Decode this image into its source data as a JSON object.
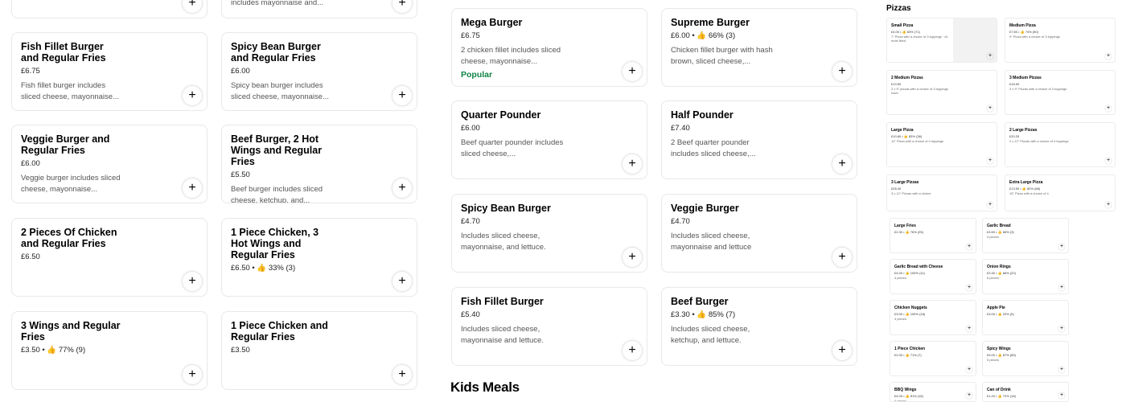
{
  "left_col1": [
    {
      "title": "",
      "price": "",
      "desc": "",
      "plus": "+"
    },
    {
      "title": "Fish Fillet Burger and Regular Fries",
      "price": "£6.75",
      "desc": "Fish fillet burger includes sliced cheese, mayonnaise...",
      "plus": "+"
    },
    {
      "title": "Veggie Burger and Regular Fries",
      "price": "£6.00",
      "desc": "Veggie burger includes sliced cheese, mayonnaise...",
      "plus": "+"
    },
    {
      "title": "2 Pieces Of Chicken and Regular Fries",
      "price": "£6.50",
      "desc": "",
      "plus": "+"
    },
    {
      "title": "3 Wings and Regular Fries",
      "price": "£3.50 • 👍 77% (9)",
      "desc": "",
      "plus": "+"
    }
  ],
  "left_col2": [
    {
      "title": "",
      "price": "",
      "desc": "includes mayonnaise and...",
      "plus": "+"
    },
    {
      "title": "Spicy Bean Burger and Regular Fries",
      "price": "£6.00",
      "desc": "Spicy bean burger includes sliced cheese, mayonnaise...",
      "plus": "+"
    },
    {
      "title": "Beef Burger, 2 Hot Wings and Regular Fries",
      "price": "£5.50",
      "desc": "Beef burger includes sliced cheese, ketchup, and...",
      "plus": "+"
    },
    {
      "title": "1 Piece Chicken, 3 Hot Wings and Regular Fries",
      "price": "£6.50 • 👍 33% (3)",
      "desc": "",
      "plus": "+"
    },
    {
      "title": "1 Piece Chicken and Regular Fries",
      "price": "£3.50",
      "desc": "",
      "plus": "+"
    }
  ],
  "mid_col1": [
    {
      "title": "Mega Burger",
      "price": "£6.75",
      "desc": "2 chicken fillet includes sliced cheese, mayonnaise...",
      "popular": "Popular",
      "plus": "+"
    },
    {
      "title": "Quarter Pounder",
      "price": "£6.00",
      "desc": "Beef quarter pounder includes sliced cheese,...",
      "popular": "",
      "plus": "+"
    },
    {
      "title": "Spicy Bean Burger",
      "price": "£4.70",
      "desc": "Includes sliced cheese, mayonnaise, and lettuce.",
      "popular": "",
      "plus": "+"
    },
    {
      "title": "Fish Fillet Burger",
      "price": "£5.40",
      "desc": "Includes sliced cheese, mayonnaise and lettuce.",
      "popular": "",
      "plus": "+"
    }
  ],
  "mid_col2": [
    {
      "title": "Supreme Burger",
      "price": "£6.00 • 👍 66% (3)",
      "desc": "Chicken fillet burger with hash brown, sliced cheese,...",
      "plus": "+"
    },
    {
      "title": "Half Pounder",
      "price": "£7.40",
      "desc": "2 Beef quarter pounder includes sliced cheese,...",
      "plus": "+"
    },
    {
      "title": "Veggie Burger",
      "price": "£4.70",
      "desc": "Includes sliced cheese, mayonnaise and lettuce",
      "plus": "+"
    },
    {
      "title": "Beef Burger",
      "price": "£3.30 • 👍 85% (7)",
      "desc": "Includes sliced cheese, ketchup, and lettuce.",
      "plus": "+"
    }
  ],
  "kids_meals_title": "Kids Meals",
  "right_panel": {
    "title": "Pizzas",
    "pizzas": [
      {
        "t": "Small Pizza",
        "p": "£4.00 • 👍 83% (71)",
        "d": "7\" Pizza with a choice of 3 toppings · #1 most liked"
      },
      {
        "t": "Medium Pizza",
        "p": "£7.50 • 👍 74% (50)",
        "d": "9\" Pizza with a choice of 3 toppings"
      },
      {
        "t": "2 Medium Pizzas",
        "p": "£13.50",
        "d": "2 x 9\" pizzas with a choice of 3 toppings each"
      },
      {
        "t": "3 Medium Pizzas",
        "p": "£18.90",
        "d": "3 x 9\" Pizzas with a choice of 3 toppings"
      },
      {
        "t": "Large Pizza",
        "p": "£10.80 • 👍 83% (36)",
        "d": "12\" Pizza with a choice of 4 toppings"
      },
      {
        "t": "2 Large Pizzas",
        "p": "£20.25",
        "d": "2 x 12\" Pizzas with a choice of 4 toppings"
      },
      {
        "t": "3 Large Pizzas",
        "p": "£28.40",
        "d": "3 x 12\" Pizzas with a choice"
      },
      {
        "t": "Extra Large Pizza",
        "p": "£13.50 • 👍 82% (68)",
        "d": "15\" Pizza with a choice of 4"
      }
    ],
    "sides": [
      {
        "t": "Large Fries",
        "p": "£2.30 • 👍 76% (25)",
        "d": ""
      },
      {
        "t": "Garlic Bread",
        "p": "£3.50 • 👍 66% (3)",
        "d": "4 pieces"
      },
      {
        "t": "Garlic Bread with Cheese",
        "p": "£4.00 • 👍 100% (11)",
        "d": "4 pieces"
      },
      {
        "t": "Onion Rings",
        "p": "£3.30 • 👍 66% (22)",
        "d": "8 pieces"
      },
      {
        "t": "Chicken Nuggets",
        "p": "£3.00 • 👍 100% (18)",
        "d": "4 pieces"
      },
      {
        "t": "Apple Pie",
        "p": "£3.00 • 👍 20% (5)",
        "d": ""
      },
      {
        "t": "1 Piece Chicken",
        "p": "£2.00 • 👍 71% (7)",
        "d": ""
      },
      {
        "t": "Spicy Wings",
        "p": "£3.00 • 👍 87% (89)",
        "d": "5 pieces"
      },
      {
        "t": "BBQ Wings",
        "p": "£4.00 • 👍 81% (16)",
        "d": "4 pieces"
      },
      {
        "t": "Can of Drink",
        "p": "£1.20 • 👍 72% (18)",
        "d": ""
      }
    ]
  }
}
